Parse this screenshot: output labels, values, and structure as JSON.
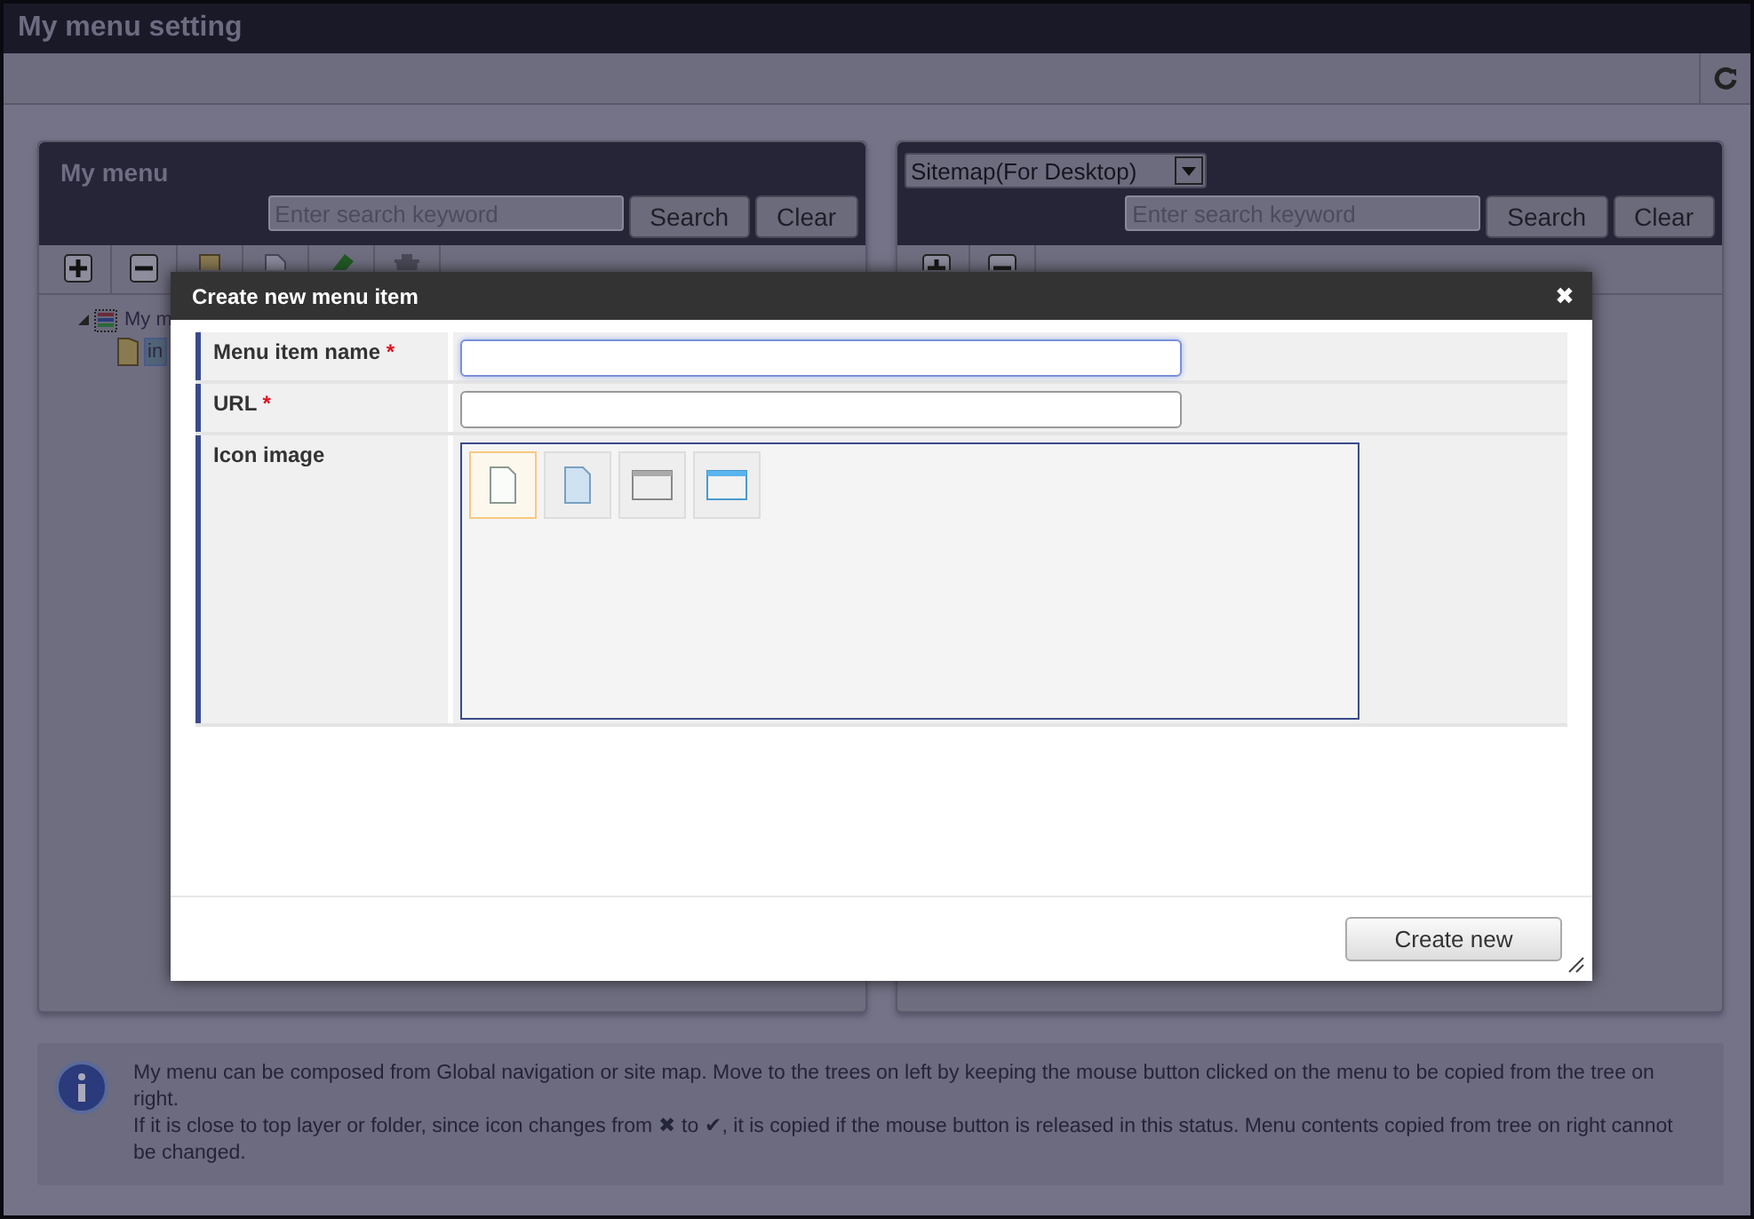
{
  "window": {
    "title": "My menu setting"
  },
  "left_panel": {
    "title": "My menu",
    "search": {
      "placeholder": "Enter search keyword"
    },
    "buttons": [
      "Search",
      "Clear"
    ],
    "tree": [
      {
        "label": "My m",
        "kind": "root",
        "expanded": true,
        "selected": false,
        "children": [
          {
            "label": "in",
            "kind": "folder",
            "selected": true
          }
        ]
      }
    ]
  },
  "right_panel": {
    "dropdown": {
      "value": "Sitemap(For Desktop)"
    },
    "search": {
      "placeholder": "Enter search keyword"
    },
    "buttons": [
      "Search",
      "Clear"
    ]
  },
  "dialog": {
    "title": "Create new menu item",
    "close": "✖",
    "fields": [
      {
        "label": "Menu item name",
        "required": true,
        "kind": "text",
        "focused": true
      },
      {
        "label": "URL",
        "required": true,
        "kind": "text",
        "focused": false
      },
      {
        "label": "Icon image",
        "required": false,
        "kind": "icons"
      }
    ],
    "required_mark": "*",
    "icon_options": [
      {
        "kind": "page",
        "selected": true
      },
      {
        "kind": "page-blue",
        "selected": false
      },
      {
        "kind": "window",
        "selected": false
      },
      {
        "kind": "window-blue",
        "selected": false
      }
    ],
    "button": "Create new"
  },
  "info": {
    "lines": [
      "My menu can be composed from Global navigation or site map. Move to the trees on left by keeping the mouse button clicked on the menu to be copied from the tree on right.",
      "If it is close to top layer or folder, since icon changes from ✖ to ✔, it is copied if the mouse button is released in this status. Menu contents copied from tree on right cannot be changed."
    ]
  }
}
